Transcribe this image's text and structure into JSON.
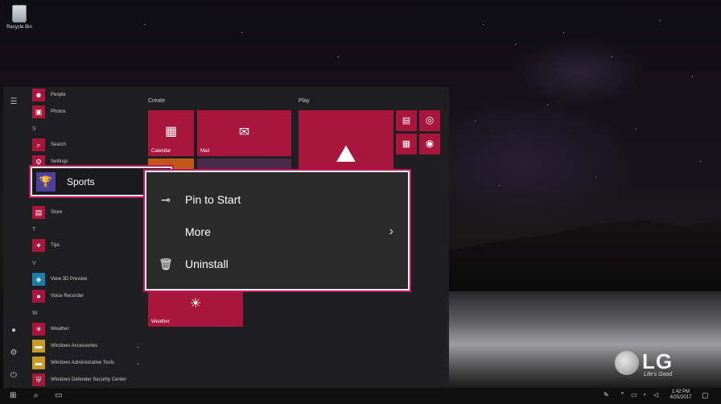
{
  "desktop": {
    "recycle_bin_label": "Recycle Bin",
    "brand": {
      "logo_text": "LG",
      "tagline": "Life's Good"
    }
  },
  "start_menu": {
    "app_list": [
      {
        "label": "People",
        "icon": "people-icon"
      },
      {
        "label": "Photos",
        "icon": "photos-icon"
      },
      {
        "section": "S"
      },
      {
        "label": "Search",
        "icon": "search-icon"
      },
      {
        "label": "Settings",
        "icon": "gear-icon"
      },
      {
        "label": "Store",
        "icon": "store-icon"
      },
      {
        "section": "T"
      },
      {
        "label": "Tips",
        "icon": "tips-icon"
      },
      {
        "section": "V"
      },
      {
        "label": "View 3D Preview",
        "icon": "cube-icon"
      },
      {
        "label": "Voice Recorder",
        "icon": "microphone-icon"
      },
      {
        "section": "W"
      },
      {
        "label": "Weather",
        "icon": "sun-icon"
      },
      {
        "label": "Windows Accessories",
        "icon": "folder-icon"
      },
      {
        "label": "Windows Administrative Tools",
        "icon": "folder-icon"
      },
      {
        "label": "Windows Defender Security Center",
        "icon": "shield-icon"
      }
    ],
    "selected_app": {
      "label": "Sports",
      "icon": "trophy-icon"
    },
    "groups": {
      "create": "Create",
      "play": "Play"
    },
    "tiles": {
      "calendar": "Calendar",
      "mail": "Mail",
      "weather": "Weather"
    }
  },
  "context_menu": {
    "items": [
      {
        "label": "Pin to Start",
        "icon": "pin-icon"
      },
      {
        "label": "More",
        "icon": "chevron-right-icon"
      },
      {
        "label": "Uninstall",
        "icon": "trash-icon"
      }
    ]
  },
  "taskbar": {
    "clock_time": "1:42 PM",
    "clock_date": "4/25/2017"
  },
  "colors": {
    "accent": "#a8163e",
    "highlight": "#c2185b"
  }
}
